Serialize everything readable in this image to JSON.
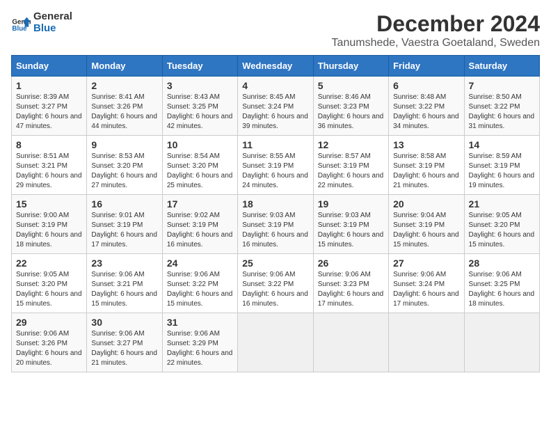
{
  "header": {
    "logo_general": "General",
    "logo_blue": "Blue",
    "title": "December 2024",
    "subtitle": "Tanumshede, Vaestra Goetaland, Sweden"
  },
  "weekdays": [
    "Sunday",
    "Monday",
    "Tuesday",
    "Wednesday",
    "Thursday",
    "Friday",
    "Saturday"
  ],
  "weeks": [
    [
      {
        "day": "1",
        "sunrise": "8:39 AM",
        "sunset": "3:27 PM",
        "daylight": "6 hours and 47 minutes."
      },
      {
        "day": "2",
        "sunrise": "8:41 AM",
        "sunset": "3:26 PM",
        "daylight": "6 hours and 44 minutes."
      },
      {
        "day": "3",
        "sunrise": "8:43 AM",
        "sunset": "3:25 PM",
        "daylight": "6 hours and 42 minutes."
      },
      {
        "day": "4",
        "sunrise": "8:45 AM",
        "sunset": "3:24 PM",
        "daylight": "6 hours and 39 minutes."
      },
      {
        "day": "5",
        "sunrise": "8:46 AM",
        "sunset": "3:23 PM",
        "daylight": "6 hours and 36 minutes."
      },
      {
        "day": "6",
        "sunrise": "8:48 AM",
        "sunset": "3:22 PM",
        "daylight": "6 hours and 34 minutes."
      },
      {
        "day": "7",
        "sunrise": "8:50 AM",
        "sunset": "3:22 PM",
        "daylight": "6 hours and 31 minutes."
      }
    ],
    [
      {
        "day": "8",
        "sunrise": "8:51 AM",
        "sunset": "3:21 PM",
        "daylight": "6 hours and 29 minutes."
      },
      {
        "day": "9",
        "sunrise": "8:53 AM",
        "sunset": "3:20 PM",
        "daylight": "6 hours and 27 minutes."
      },
      {
        "day": "10",
        "sunrise": "8:54 AM",
        "sunset": "3:20 PM",
        "daylight": "6 hours and 25 minutes."
      },
      {
        "day": "11",
        "sunrise": "8:55 AM",
        "sunset": "3:19 PM",
        "daylight": "6 hours and 24 minutes."
      },
      {
        "day": "12",
        "sunrise": "8:57 AM",
        "sunset": "3:19 PM",
        "daylight": "6 hours and 22 minutes."
      },
      {
        "day": "13",
        "sunrise": "8:58 AM",
        "sunset": "3:19 PM",
        "daylight": "6 hours and 21 minutes."
      },
      {
        "day": "14",
        "sunrise": "8:59 AM",
        "sunset": "3:19 PM",
        "daylight": "6 hours and 19 minutes."
      }
    ],
    [
      {
        "day": "15",
        "sunrise": "9:00 AM",
        "sunset": "3:19 PM",
        "daylight": "6 hours and 18 minutes."
      },
      {
        "day": "16",
        "sunrise": "9:01 AM",
        "sunset": "3:19 PM",
        "daylight": "6 hours and 17 minutes."
      },
      {
        "day": "17",
        "sunrise": "9:02 AM",
        "sunset": "3:19 PM",
        "daylight": "6 hours and 16 minutes."
      },
      {
        "day": "18",
        "sunrise": "9:03 AM",
        "sunset": "3:19 PM",
        "daylight": "6 hours and 16 minutes."
      },
      {
        "day": "19",
        "sunrise": "9:03 AM",
        "sunset": "3:19 PM",
        "daylight": "6 hours and 15 minutes."
      },
      {
        "day": "20",
        "sunrise": "9:04 AM",
        "sunset": "3:19 PM",
        "daylight": "6 hours and 15 minutes."
      },
      {
        "day": "21",
        "sunrise": "9:05 AM",
        "sunset": "3:20 PM",
        "daylight": "6 hours and 15 minutes."
      }
    ],
    [
      {
        "day": "22",
        "sunrise": "9:05 AM",
        "sunset": "3:20 PM",
        "daylight": "6 hours and 15 minutes."
      },
      {
        "day": "23",
        "sunrise": "9:06 AM",
        "sunset": "3:21 PM",
        "daylight": "6 hours and 15 minutes."
      },
      {
        "day": "24",
        "sunrise": "9:06 AM",
        "sunset": "3:22 PM",
        "daylight": "6 hours and 15 minutes."
      },
      {
        "day": "25",
        "sunrise": "9:06 AM",
        "sunset": "3:22 PM",
        "daylight": "6 hours and 16 minutes."
      },
      {
        "day": "26",
        "sunrise": "9:06 AM",
        "sunset": "3:23 PM",
        "daylight": "6 hours and 17 minutes."
      },
      {
        "day": "27",
        "sunrise": "9:06 AM",
        "sunset": "3:24 PM",
        "daylight": "6 hours and 17 minutes."
      },
      {
        "day": "28",
        "sunrise": "9:06 AM",
        "sunset": "3:25 PM",
        "daylight": "6 hours and 18 minutes."
      }
    ],
    [
      {
        "day": "29",
        "sunrise": "9:06 AM",
        "sunset": "3:26 PM",
        "daylight": "6 hours and 20 minutes."
      },
      {
        "day": "30",
        "sunrise": "9:06 AM",
        "sunset": "3:27 PM",
        "daylight": "6 hours and 21 minutes."
      },
      {
        "day": "31",
        "sunrise": "9:06 AM",
        "sunset": "3:29 PM",
        "daylight": "6 hours and 22 minutes."
      },
      null,
      null,
      null,
      null
    ]
  ]
}
